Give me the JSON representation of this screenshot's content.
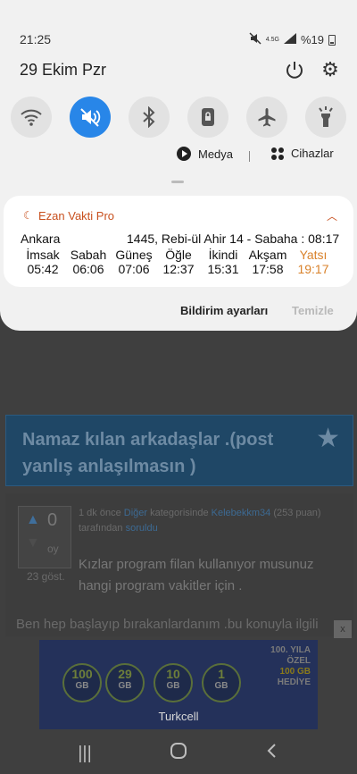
{
  "status_bar": {
    "time": "21:25",
    "lte_label": "4.5G",
    "battery": "%19"
  },
  "quick_panel": {
    "date": "29 Ekim Pzr",
    "tiles": [
      {
        "name": "wifi",
        "active": false
      },
      {
        "name": "mute",
        "active": true
      },
      {
        "name": "bluetooth",
        "active": false
      },
      {
        "name": "rotation-lock",
        "active": false
      },
      {
        "name": "airplane",
        "active": false
      },
      {
        "name": "flashlight",
        "active": false
      }
    ],
    "media_label": "Medya",
    "devices_label": "Cihazlar"
  },
  "notification": {
    "app_name": "Ezan Vakti Pro",
    "city": "Ankara",
    "hijri_line": "1445, Rebi-ül Ahir 14 - Sabaha : 08:17",
    "prayers": [
      {
        "name": "İmsak",
        "time": "05:42"
      },
      {
        "name": "Sabah",
        "time": "06:06"
      },
      {
        "name": "Güneş",
        "time": "07:06"
      },
      {
        "name": "Öğle",
        "time": "12:37"
      },
      {
        "name": "İkindi",
        "time": "15:31"
      },
      {
        "name": "Akşam",
        "time": "17:58"
      },
      {
        "name": "Yatsı",
        "time": "19:17"
      }
    ],
    "current_color": "#d9822b",
    "settings_label": "Bildirim ayarları",
    "clear_label": "Temizle"
  },
  "background_page": {
    "title": "Namaz kılan arkadaşlar .(post yanlış anlaşılmasın )",
    "votes": "0",
    "vote_label": "oy",
    "views": "23 göst.",
    "meta_prefix": "1 dk önce",
    "category": "Diğer",
    "meta_mid": "kategorisinde",
    "user": "Kelebekkm34",
    "points": "(253 puan)",
    "meta_suffix": "tarafından",
    "asked": "soruldu",
    "question": "Kızlar program filan kullanıyor musunuz hangi program vakitler için .",
    "extra_line": "Ben hep başlayıp bırakanlardanım .bu konuyla ilgili"
  },
  "ad": {
    "close_label": "x",
    "packages": [
      {
        "value": "100",
        "unit": "GB"
      },
      {
        "value": "29",
        "unit": "GB"
      },
      {
        "value": "10",
        "unit": "GB"
      },
      {
        "value": "1",
        "unit": "GB"
      }
    ],
    "promo_line1": "100. YILA",
    "promo_line2": "ÖZEL",
    "promo_line3": "100 GB",
    "promo_line4": "HEDİYE",
    "brand": "Turkcell"
  },
  "colors": {
    "accent": "#2886e8",
    "app": "#c8501e",
    "highlight": "#d9822b"
  }
}
